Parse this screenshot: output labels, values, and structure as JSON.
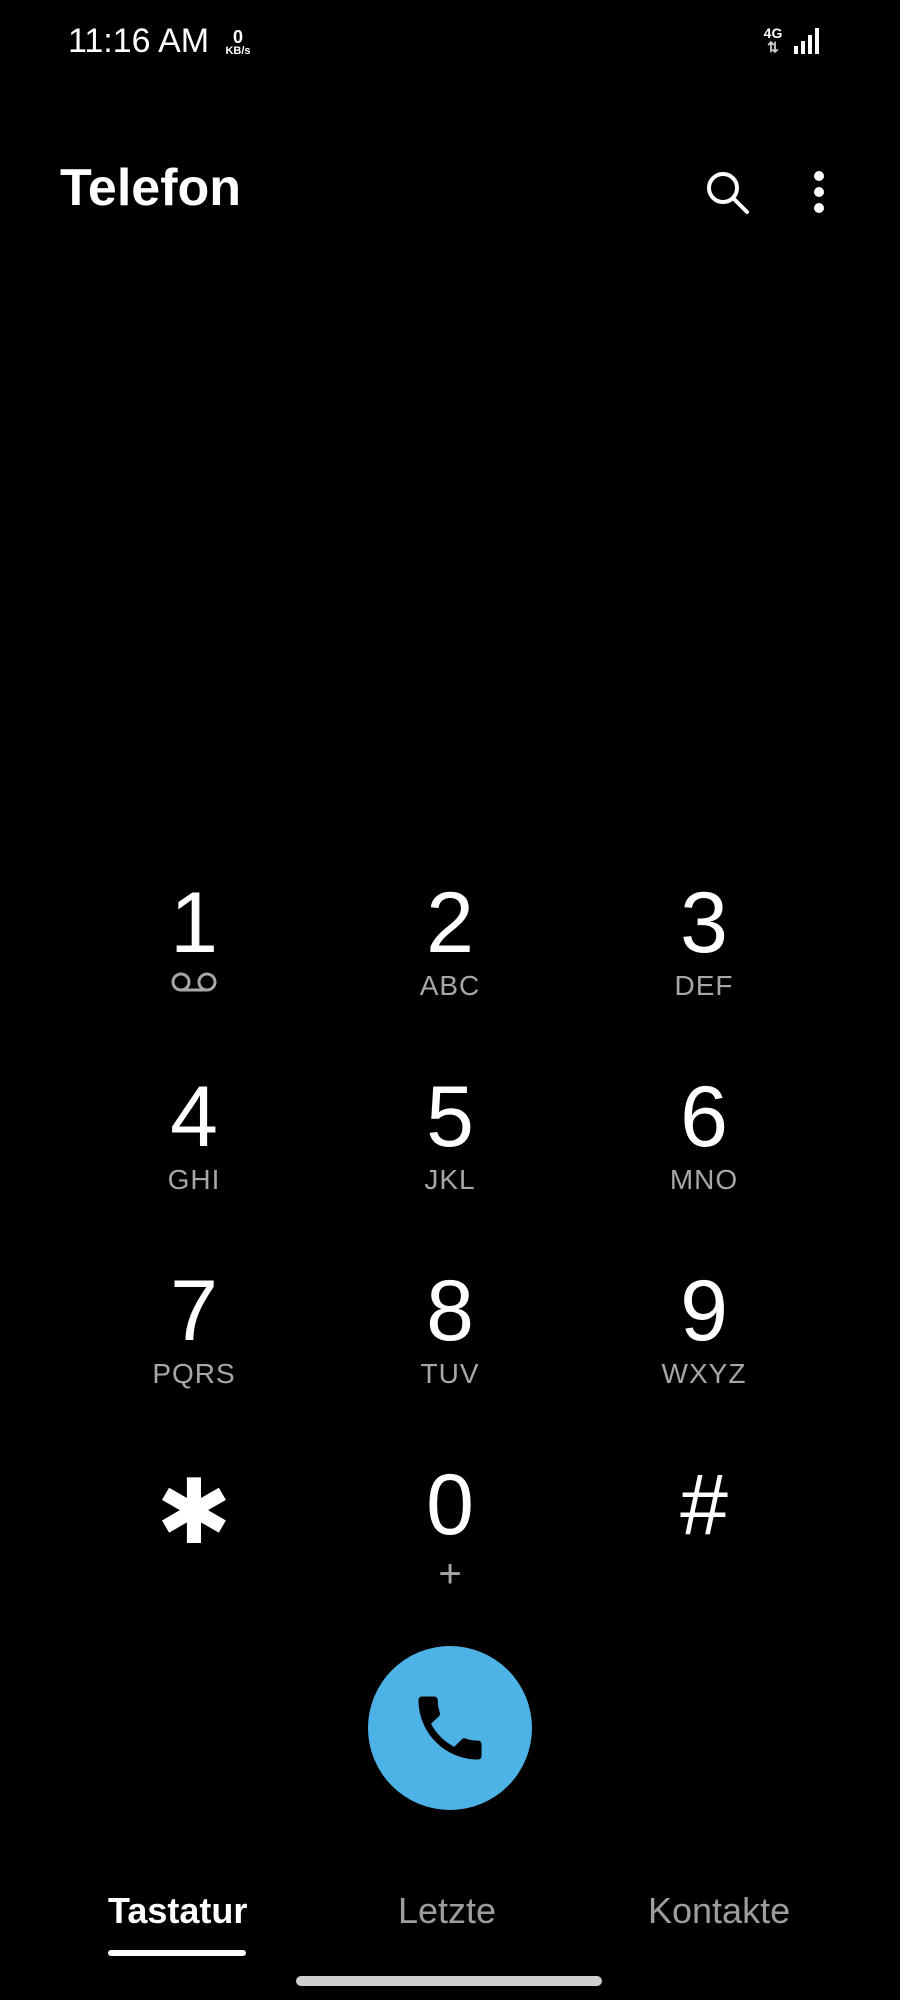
{
  "status_bar": {
    "time": "11:16 AM",
    "speed_value": "0",
    "speed_unit": "KB/s",
    "network": "4G",
    "signal_icon": "signal-bars-icon"
  },
  "header": {
    "title": "Telefon",
    "search_icon": "search-icon",
    "more_icon": "more-vert-icon"
  },
  "keypad": {
    "keys": [
      {
        "digit": "1",
        "sub": "",
        "icon": "voicemail-icon"
      },
      {
        "digit": "2",
        "sub": "ABC"
      },
      {
        "digit": "3",
        "sub": "DEF"
      },
      {
        "digit": "4",
        "sub": "GHI"
      },
      {
        "digit": "5",
        "sub": "JKL"
      },
      {
        "digit": "6",
        "sub": "MNO"
      },
      {
        "digit": "7",
        "sub": "PQRS"
      },
      {
        "digit": "8",
        "sub": "TUV"
      },
      {
        "digit": "9",
        "sub": "WXYZ"
      },
      {
        "digit": "✱",
        "sub": ""
      },
      {
        "digit": "0",
        "sub": "+"
      },
      {
        "digit": "#",
        "sub": ""
      }
    ]
  },
  "call_button": {
    "icon": "phone-icon",
    "color": "#4db3e6"
  },
  "tabs": [
    {
      "label": "Tastatur",
      "active": true
    },
    {
      "label": "Letzte",
      "active": false
    },
    {
      "label": "Kontakte",
      "active": false
    }
  ]
}
